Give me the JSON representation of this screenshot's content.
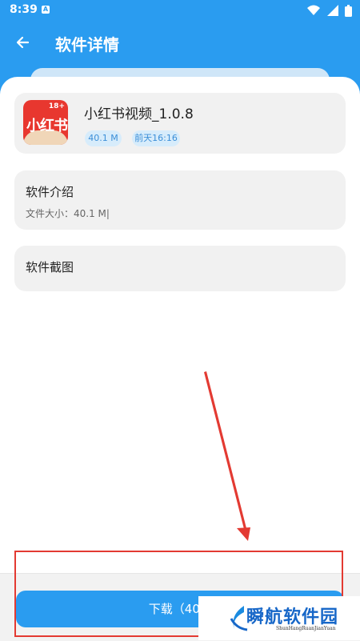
{
  "status_bar": {
    "time": "8:39",
    "notification_letter": "A"
  },
  "header": {
    "title": "软件详情"
  },
  "app": {
    "name": "小红书视频_1.0.8",
    "icon_label": "小红书",
    "icon_badge": "18+",
    "size_tag": "40.1 M",
    "time_tag": "前天16:16"
  },
  "intro": {
    "heading": "软件介绍",
    "file_size": "文件大小：40.1 M|"
  },
  "screenshots": {
    "heading": "软件截图"
  },
  "download": {
    "label": "下载（40.1"
  },
  "watermark": {
    "text": "瞬航软件园",
    "subtitle": "ShunHangRuanJianYuan"
  },
  "colors": {
    "primary": "#2a9cf0",
    "annotation": "#e33a32",
    "card_bg": "#f1f1f1"
  }
}
